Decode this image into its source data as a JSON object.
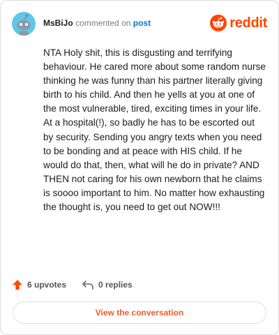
{
  "header": {
    "username": "MsBiJo",
    "action_text": "commented on",
    "post_link": "post",
    "brand": "reddit"
  },
  "avatar": {
    "icon": "snoo-avatar-icon",
    "color": "#5ec8e6"
  },
  "comment": {
    "text": "NTA Holy shit, this is disgusting and terrifying behaviour. He cared more about some random nurse thinking he was funny than his partner literally giving birth to his child. And then he yells at you at one of the most vulnerable, tired, exciting times in your life. At a hospital(!), so badly he has to be escorted out by security. Sending you angry texts when you need to be bonding and at peace with HIS child. If he would do that, then, what will he do in private? AND THEN not caring for his own newborn that he claims is soooo important to him. No matter how exhausting the thought is, you need to get out NOW!!!"
  },
  "actions": {
    "upvotes": {
      "label": "6 upvotes",
      "icon": "upvote-arrow-icon",
      "color": "#ff4500"
    },
    "replies": {
      "label": "0 replies",
      "icon": "reply-arrow-icon"
    }
  },
  "cta": {
    "label": "View the conversation",
    "color": "#ef5b26"
  },
  "colors": {
    "brand": "#ff4500",
    "link": "#0079d3",
    "border": "#dcdcdc"
  }
}
